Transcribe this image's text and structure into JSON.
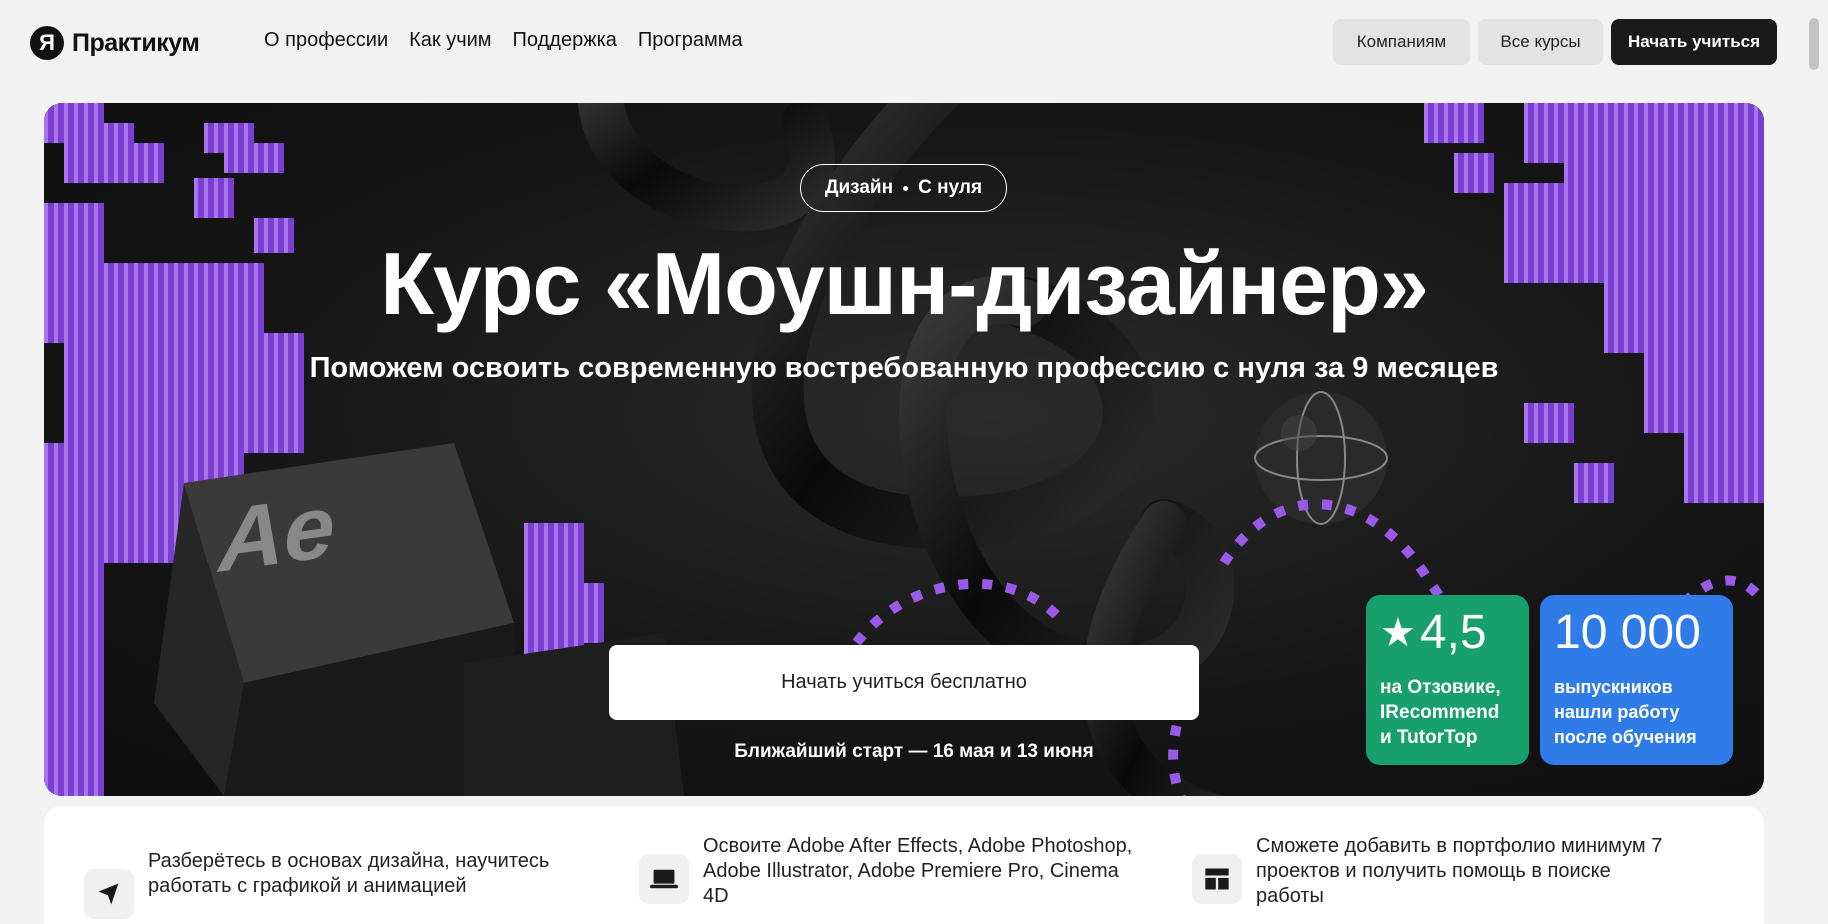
{
  "header": {
    "logo_mark": "Я",
    "logo_text": "Практикум",
    "nav": [
      "О профессии",
      "Как учим",
      "Поддержка",
      "Программа"
    ],
    "companies_label": "Компаниям",
    "courses_label": "Все курсы",
    "start_label": "Начать учиться"
  },
  "hero": {
    "tag_left": "Дизайн",
    "tag_right": "С нуля",
    "title": "Курс «Моушн-дизайнер»",
    "subtitle": "Поможем освоить современную востребованную профессию с нуля за 9 месяцев",
    "cta_label": "Начать учиться бесплатно",
    "start_date": "Ближайший старт — 16 мая и 13 июня",
    "ae_label": "Ae",
    "rating": {
      "value": "4,5",
      "lines": [
        "на Отзовике,",
        "IRecommend",
        "и TutorTop"
      ]
    },
    "grads": {
      "value": "10 000",
      "lines": [
        "выпускников",
        "нашли работу",
        "после обучения"
      ]
    }
  },
  "features": [
    {
      "icon": "cursor-icon",
      "text": "Разберётесь в основах дизайна, научитесь работать с графикой и анимацией"
    },
    {
      "icon": "laptop-icon",
      "text": "Освоите Adobe After Effects, Adobe Photoshop, Adobe Illustrator, Adobe Premiere Pro, Cinema 4D"
    },
    {
      "icon": "layout-icon",
      "text": "Сможете добавить в портфолио минимум 7 проектов и получить помощь в поиске работы"
    }
  ],
  "colors": {
    "purple": "#8a4fd8",
    "rating_green": "#17a06e",
    "grads_blue": "#2f7be8"
  }
}
